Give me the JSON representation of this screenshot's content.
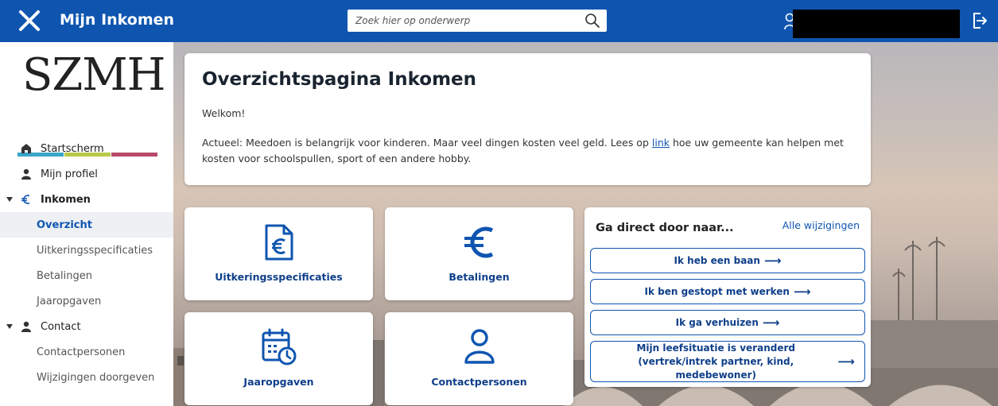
{
  "header": {
    "title": "Mijn Inkomen",
    "search_placeholder": "Zoek hier op onderwerp"
  },
  "logo": {
    "text": "SZMH",
    "bar_colors": [
      "#3aa6c8",
      "#b8c94a",
      "#b84a6a"
    ]
  },
  "sidebar": {
    "items": [
      {
        "label": "Startscherm",
        "icon": "home-icon"
      },
      {
        "label": "Mijn profiel",
        "icon": "person-icon"
      },
      {
        "label": "Inkomen",
        "icon": "euro-icon"
      },
      {
        "label": "Overzicht"
      },
      {
        "label": "Uitkeringsspecificaties"
      },
      {
        "label": "Betalingen"
      },
      {
        "label": "Jaaropgaven"
      },
      {
        "label": "Contact",
        "icon": "person-icon"
      },
      {
        "label": "Contactpersonen"
      },
      {
        "label": "Wijzigingen doorgeven"
      }
    ]
  },
  "intro": {
    "title": "Overzichtspagina Inkomen",
    "welcome": "Welkom!",
    "text_before_link": "Actueel: Meedoen is belangrijk voor kinderen. Maar veel dingen kosten veel geld. Lees op ",
    "link": "link",
    "text_after_link": " hoe uw gemeente kan helpen met kosten voor schoolspullen, sport of een andere hobby."
  },
  "tiles": [
    {
      "label": "Uitkeringsspecificaties",
      "icon": "euro-document-icon"
    },
    {
      "label": "Betalingen",
      "icon": "euro-icon"
    },
    {
      "label": "Jaaropgaven",
      "icon": "calendar-clock-icon"
    },
    {
      "label": "Contactpersonen",
      "icon": "person-icon"
    }
  ],
  "direct": {
    "title": "Ga direct door naar...",
    "all_link": "Alle wijzigingen",
    "buttons": [
      {
        "label": "Ik heb een baan"
      },
      {
        "label": "Ik ben gestopt met werken"
      },
      {
        "label": "Ik ga verhuizen"
      },
      {
        "label": "Mijn leefsituatie is veranderd (vertrek/intrek partner, kind, medebewoner)"
      }
    ],
    "arrow": "⟶"
  },
  "colors": {
    "brand": "#0f55b0",
    "link": "#0f55b0",
    "active_bg": "#eef0f4"
  }
}
